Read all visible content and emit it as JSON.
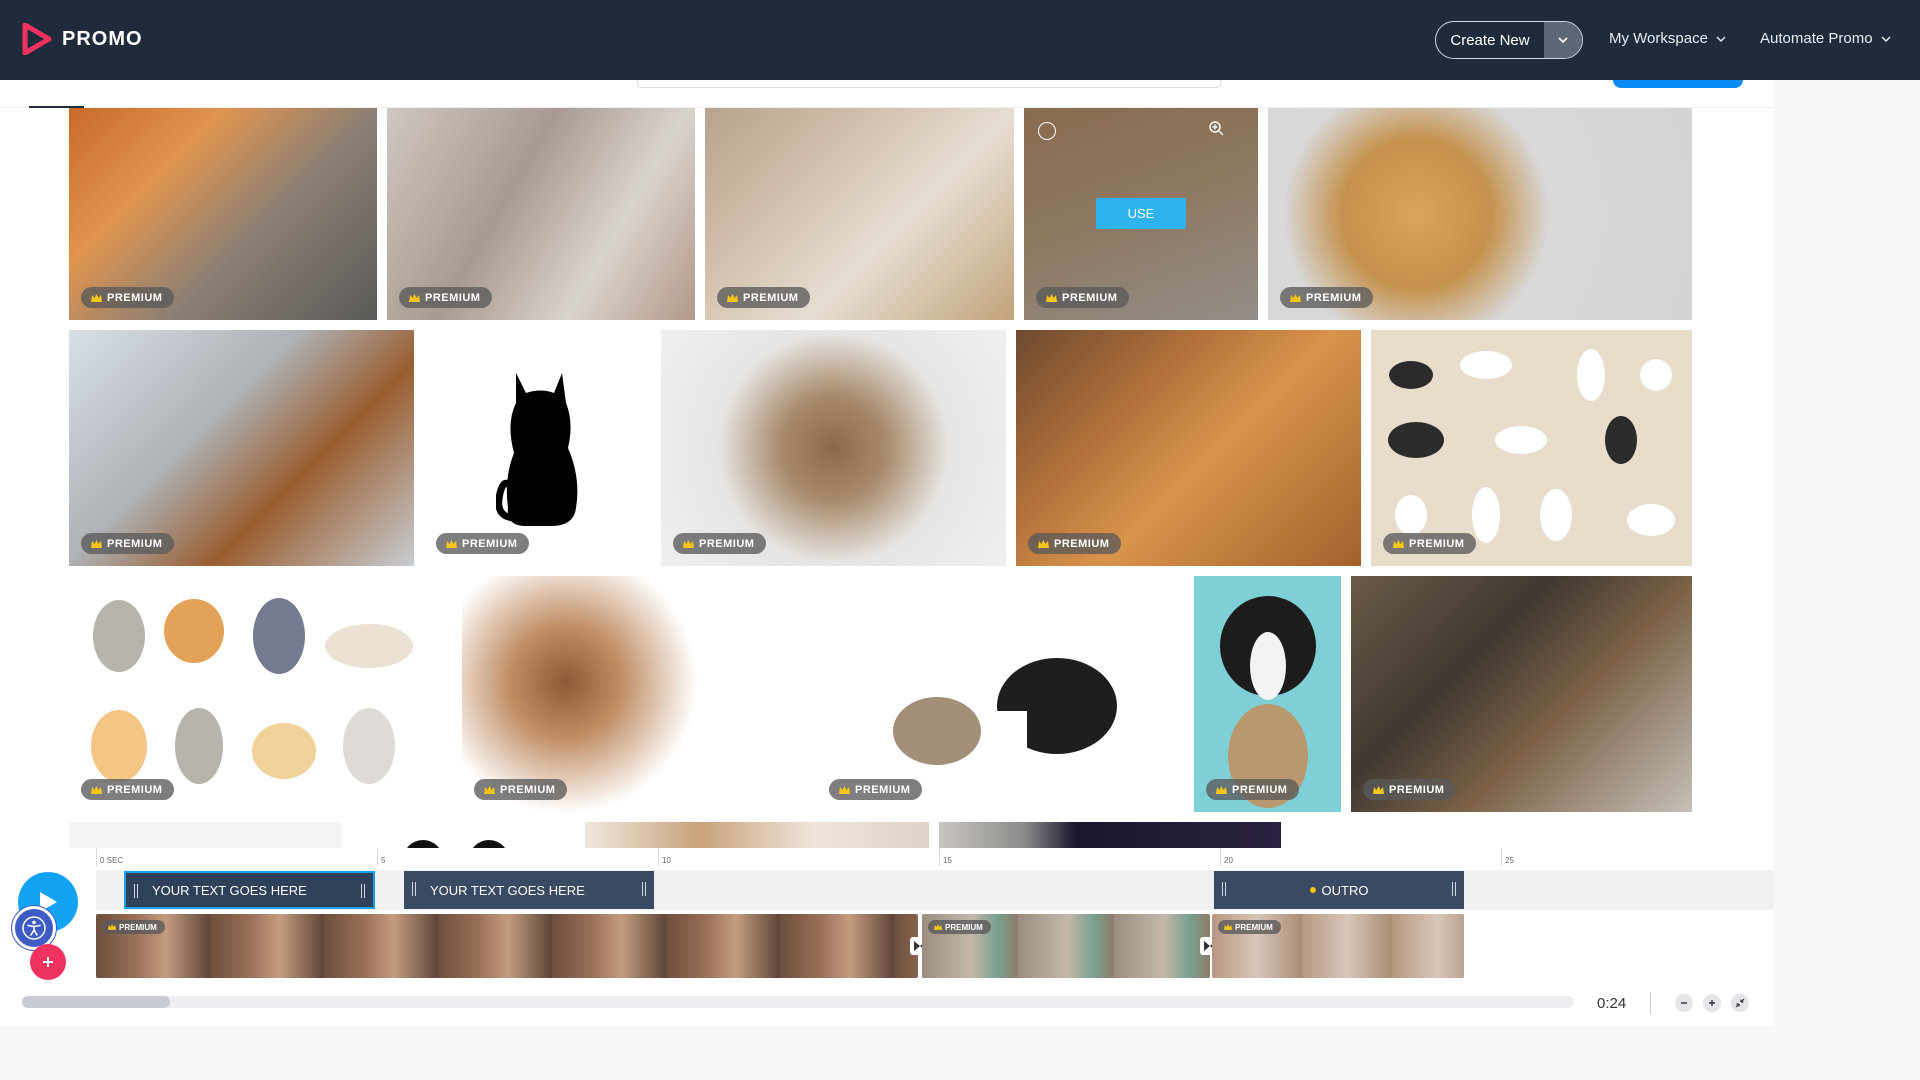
{
  "app": {
    "name": "PROMO"
  },
  "nav": {
    "create_new": "Create New",
    "workspace": "My Workspace",
    "automate": "Automate Promo"
  },
  "gallery": {
    "premium_label": "PREMIUM",
    "use_label": "USE"
  },
  "timeline": {
    "ticks": [
      "0 SEC",
      "5",
      "10",
      "15",
      "20",
      "25"
    ],
    "text_clips": [
      "YOUR TEXT GOES HERE",
      "YOUR TEXT GOES HERE",
      "OUTRO"
    ],
    "video_badge": "PREMIUM",
    "duration": "0:24"
  },
  "icons": {
    "play": "play-icon",
    "accessibility": "accessibility-icon",
    "add": "plus-icon",
    "zoom_out": "minus-icon",
    "zoom_in": "plus-icon",
    "fit": "collapse-icon",
    "chevron": "chevron-down-icon",
    "crown": "crown-icon"
  },
  "colors": {
    "nav_bg": "#1f2a3a",
    "accent_blue": "#12a4f2",
    "brand_pink": "#f0325e",
    "text_clip_bg": "#3a4a63"
  }
}
